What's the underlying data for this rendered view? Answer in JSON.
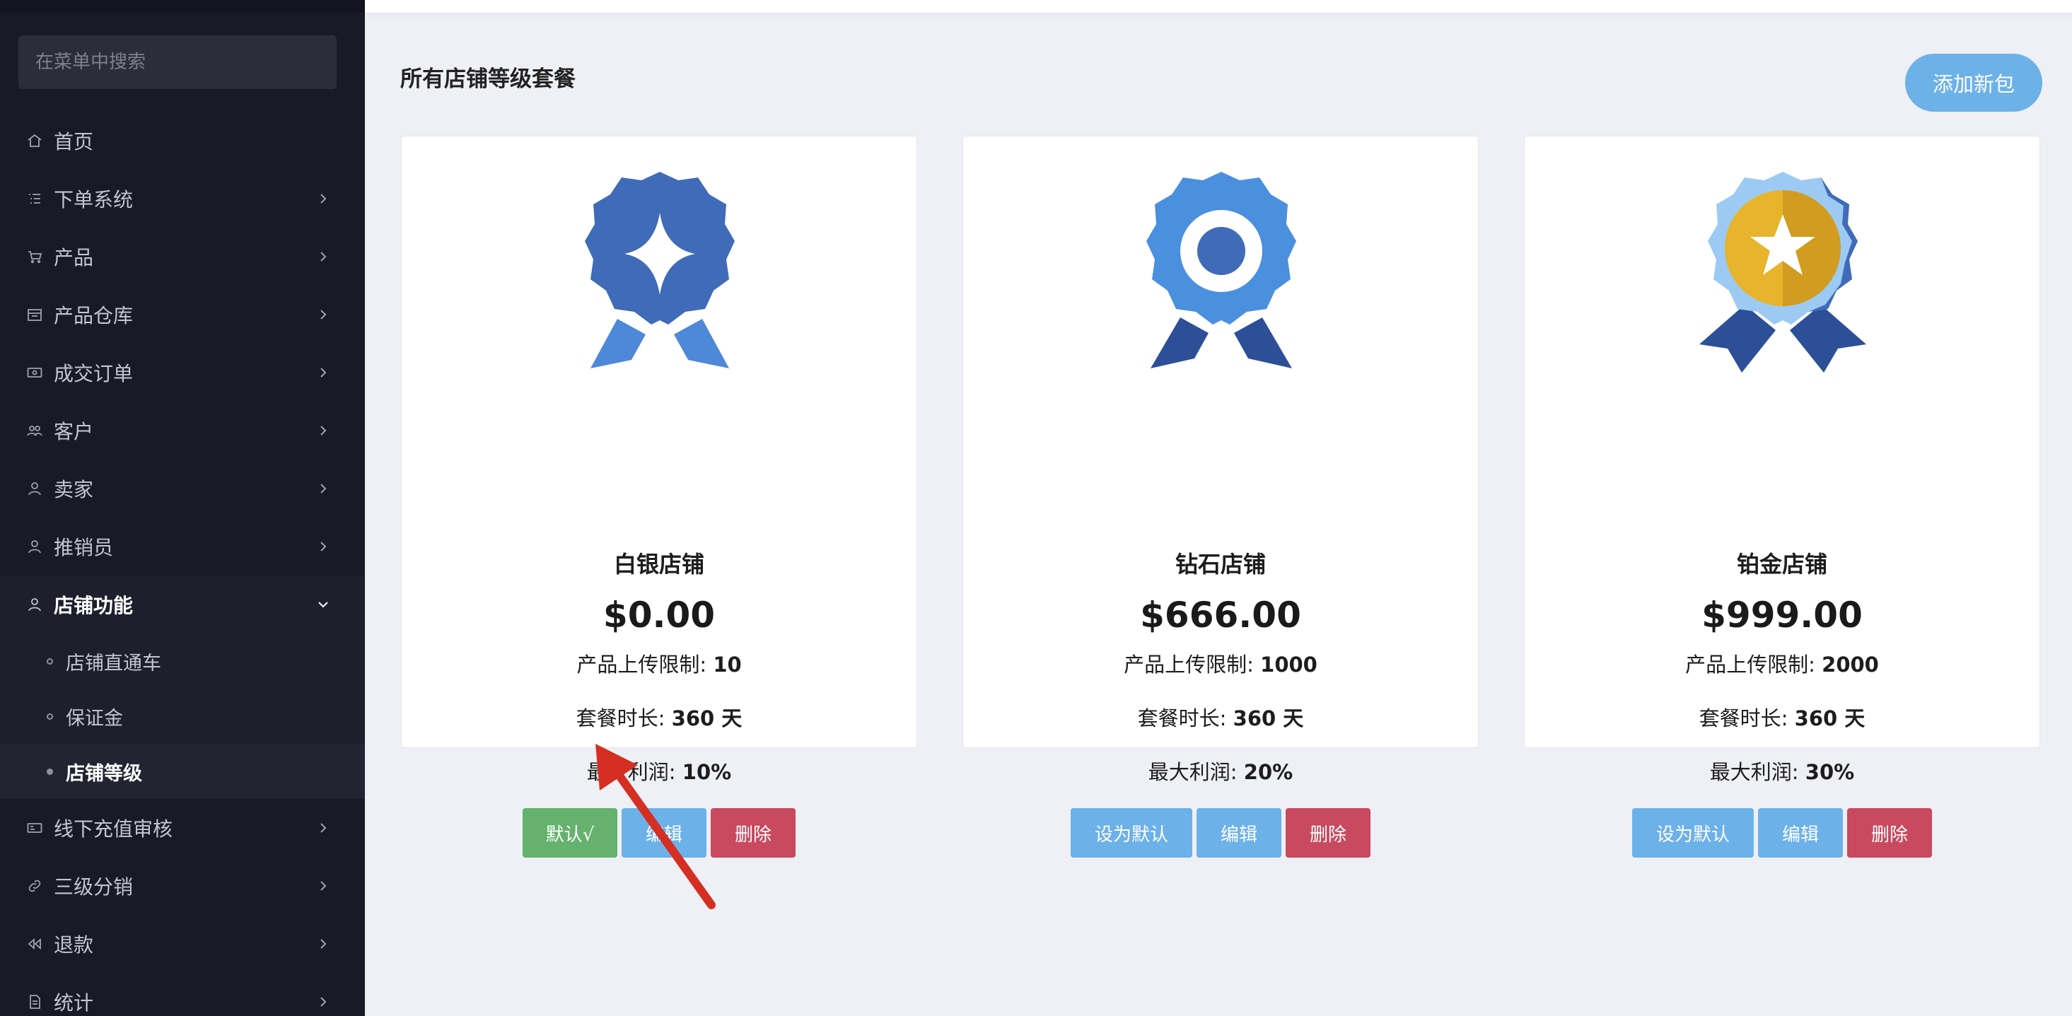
{
  "sidebar": {
    "search_placeholder": "在菜单中搜索",
    "items": [
      {
        "label": "首页",
        "icon": "home-icon"
      },
      {
        "label": "下单系统",
        "icon": "list-icon"
      },
      {
        "label": "产品",
        "icon": "cart-icon"
      },
      {
        "label": "产品仓库",
        "icon": "warehouse-icon"
      },
      {
        "label": "成交订单",
        "icon": "money-icon"
      },
      {
        "label": "客户",
        "icon": "users-icon"
      },
      {
        "label": "卖家",
        "icon": "user-icon"
      },
      {
        "label": "推销员",
        "icon": "user-icon"
      },
      {
        "label": "店铺功能",
        "icon": "user-icon",
        "expanded": true
      },
      {
        "label": "线下充值审核",
        "icon": "money-icon"
      },
      {
        "label": "三级分销",
        "icon": "link-icon"
      },
      {
        "label": "退款",
        "icon": "rewind-icon"
      },
      {
        "label": "统计",
        "icon": "document-icon"
      }
    ],
    "submenu": [
      {
        "label": "店铺直通车"
      },
      {
        "label": "保证金"
      },
      {
        "label": "店铺等级",
        "active": true
      }
    ]
  },
  "main": {
    "title": "所有店铺等级套餐",
    "add_button": "添加新包",
    "labels": {
      "upload_limit": "产品上传限制: ",
      "duration": "套餐时长: ",
      "max_profit": "最大利润: "
    },
    "packages": [
      {
        "name": "白银店铺",
        "price": "$0.00",
        "upload_limit": "10",
        "duration": "360 天",
        "max_profit": "10%",
        "default_label": "默认√",
        "edit": "编辑",
        "delete": "删除",
        "is_default": true,
        "badge_icon": "diamond-badge-icon"
      },
      {
        "name": "钻石店铺",
        "price": "$666.00",
        "upload_limit": "1000",
        "duration": "360 天",
        "max_profit": "20%",
        "default_label": "设为默认",
        "edit": "编辑",
        "delete": "删除",
        "is_default": false,
        "badge_icon": "ring-badge-icon"
      },
      {
        "name": "铂金店铺",
        "price": "$999.00",
        "upload_limit": "2000",
        "duration": "360 天",
        "max_profit": "30%",
        "default_label": "设为默认",
        "edit": "编辑",
        "delete": "删除",
        "is_default": false,
        "badge_icon": "star-badge-icon"
      }
    ]
  },
  "colors": {
    "sidebar_bg": "#181a27",
    "default_green": "#64b26d",
    "action_blue": "#6db1e9",
    "delete_red": "#c9495f",
    "annotation_arrow": "#d42f22"
  }
}
